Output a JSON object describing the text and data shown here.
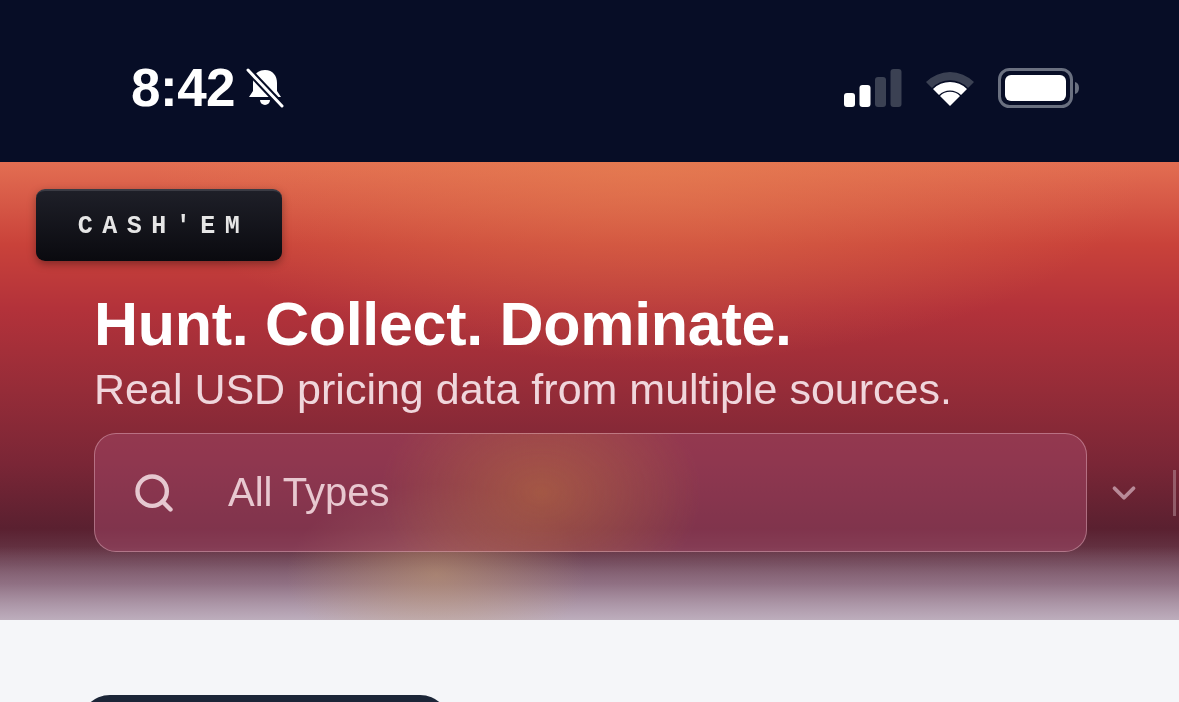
{
  "status_bar": {
    "time": "8:42"
  },
  "hero": {
    "logo": "CASH'EM",
    "heading": "Hunt. Collect. Dominate.",
    "subtitle": "Real USD pricing data from multiple sources.",
    "search": {
      "placeholder": "All Types"
    }
  }
}
